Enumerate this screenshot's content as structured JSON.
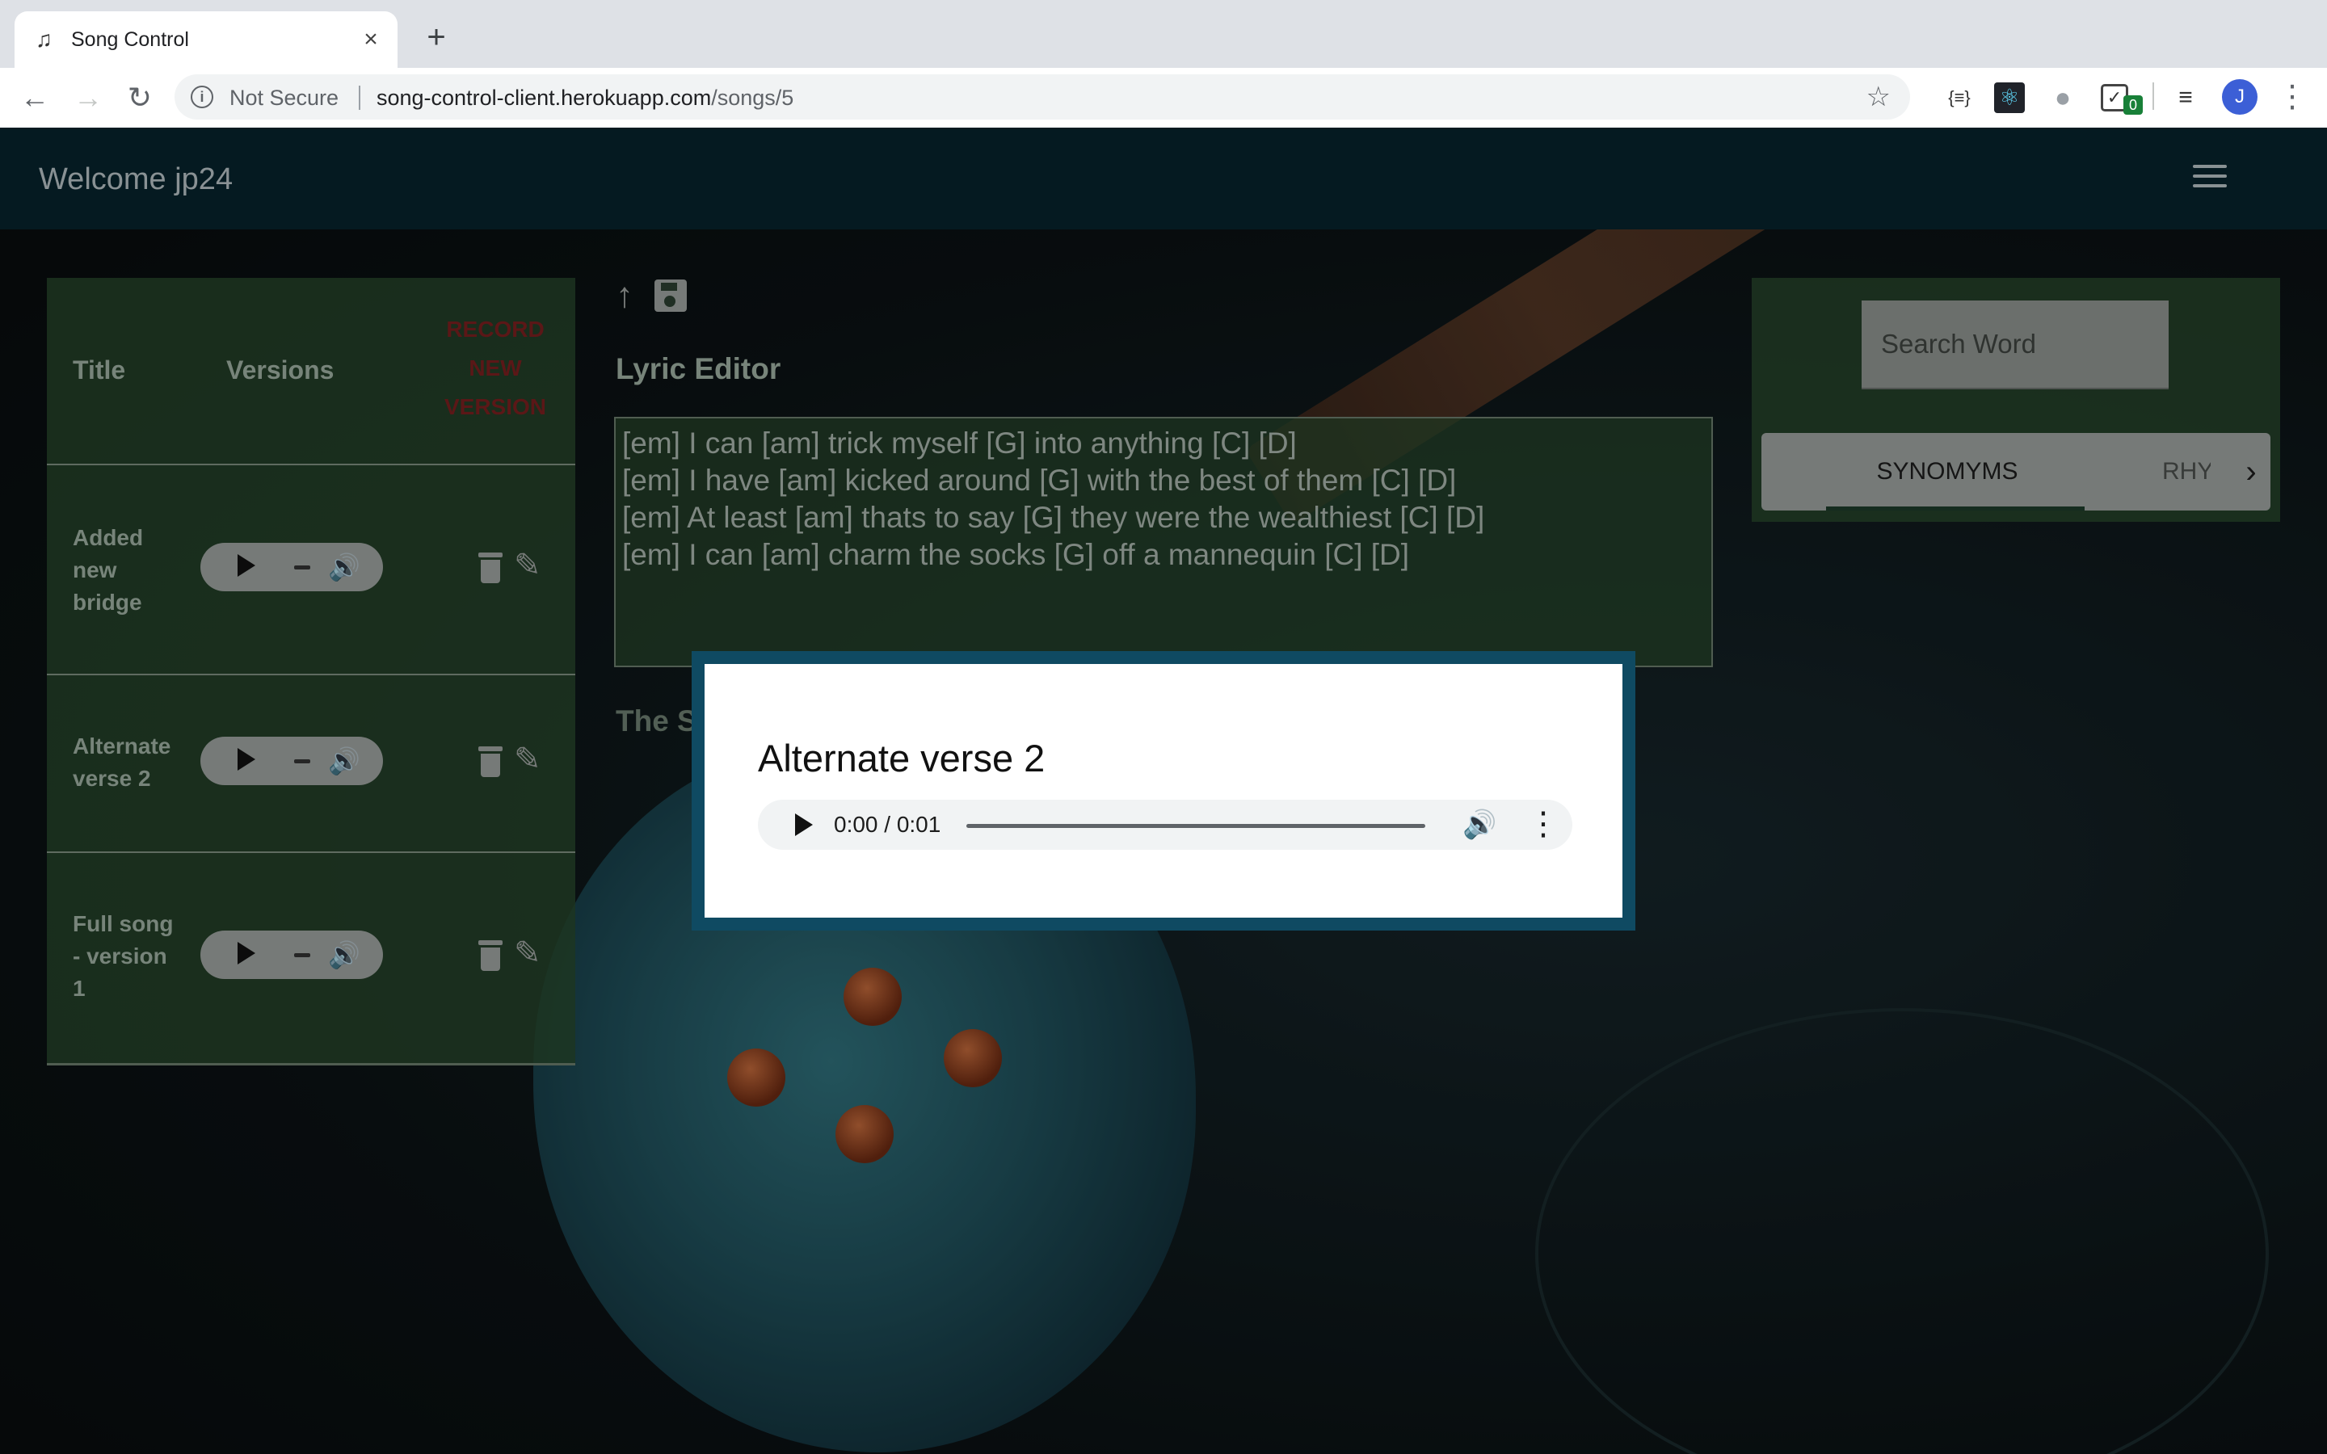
{
  "browser": {
    "tab_title": "Song Control",
    "tab_favicon": "music-note-icon",
    "security_label": "Not Secure",
    "url_host": "song-control-client.herokuapp.com",
    "url_path": "/songs/5",
    "extension_badge": "0",
    "profile_initial": "J"
  },
  "header": {
    "welcome": "Welcome jp24",
    "menu_icon": "hamburger-icon"
  },
  "versions_panel": {
    "col_title": "Title",
    "col_versions": "Versions",
    "record_label": "RECORD NEW VERSION",
    "rows": [
      {
        "title": "Added new bridge"
      },
      {
        "title": "Alternate verse 2"
      },
      {
        "title": "Full song - version 1"
      }
    ]
  },
  "editor": {
    "title": "Lyric Editor",
    "lines": [
      "[em] I can [am] trick myself [G] into anything [C] [D]",
      "[em] I have [am] kicked around [G] with the best of them [C] [D]",
      "[em] At least [am] thats to say [G] they were the wealthiest [C] [D]",
      "[em] I can [am] charm the socks [G] off a mannequin [C] [D]"
    ],
    "section_partial": "The S"
  },
  "thesaurus": {
    "search_placeholder": "Search Word",
    "tab_synonyms": "SYNOMYMS",
    "tab_rhymes": "RHY"
  },
  "modal": {
    "title": "Alternate verse 2",
    "audio_time": "0:00 / 0:01"
  },
  "colors": {
    "header_bg": "#07232c",
    "panel_bg": "#28482c",
    "modal_border": "#0f4a62",
    "record_red": "#7a1f1f"
  }
}
